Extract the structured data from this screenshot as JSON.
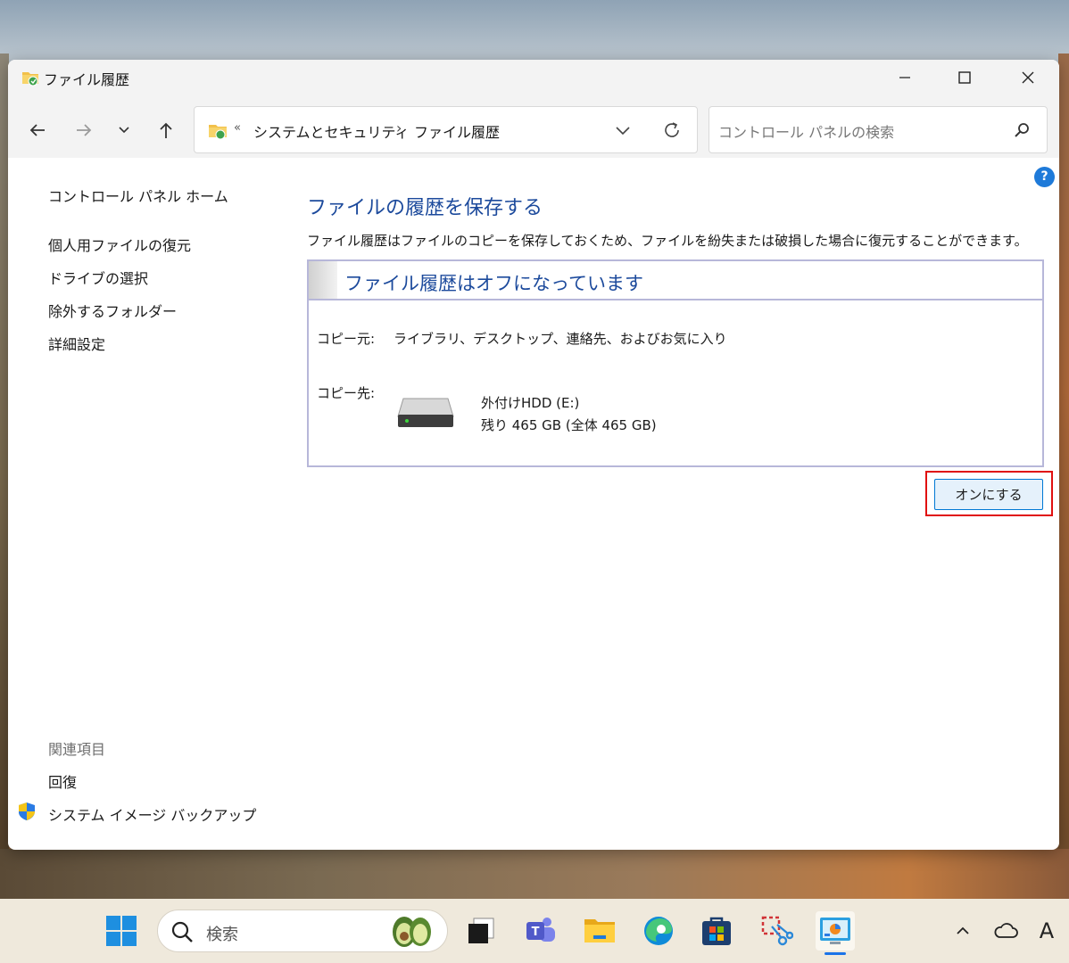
{
  "window": {
    "title": "ファイル履歴",
    "icon": "folder-history-icon"
  },
  "nav": {
    "breadcrumb_overflow": "«",
    "crumbs": [
      "システムとセキュリティ",
      "ファイル履歴"
    ],
    "crumb_separator": "›",
    "search_placeholder": "コントロール パネルの検索"
  },
  "help_label": "?",
  "sidebar": {
    "home": "コントロール パネル ホーム",
    "items": [
      "個人用ファイルの復元",
      "ドライブの選択",
      "除外するフォルダー",
      "詳細設定"
    ],
    "related_heading": "関連項目",
    "related": [
      "回復",
      "システム イメージ バックアップ"
    ]
  },
  "main": {
    "heading": "ファイルの履歴を保存する",
    "description": "ファイル履歴はファイルのコピーを保存しておくため、ファイルを紛失または破損した場合に復元することができます。",
    "status_title": "ファイル履歴はオフになっています",
    "source_label": "コピー元:",
    "source_value": "ライブラリ、デスクトップ、連絡先、およびお気に入り",
    "dest_label": "コピー先:",
    "drive_name": "外付けHDD (E:)",
    "drive_space": "残り 465 GB (全体 465 GB)",
    "turn_on_button": "オンにする"
  },
  "taskbar": {
    "search_label": "検索",
    "ime_label": "A"
  },
  "colors": {
    "link_blue": "#1c4a9c",
    "accent": "#0078d4",
    "highlight_red": "#e01010"
  }
}
